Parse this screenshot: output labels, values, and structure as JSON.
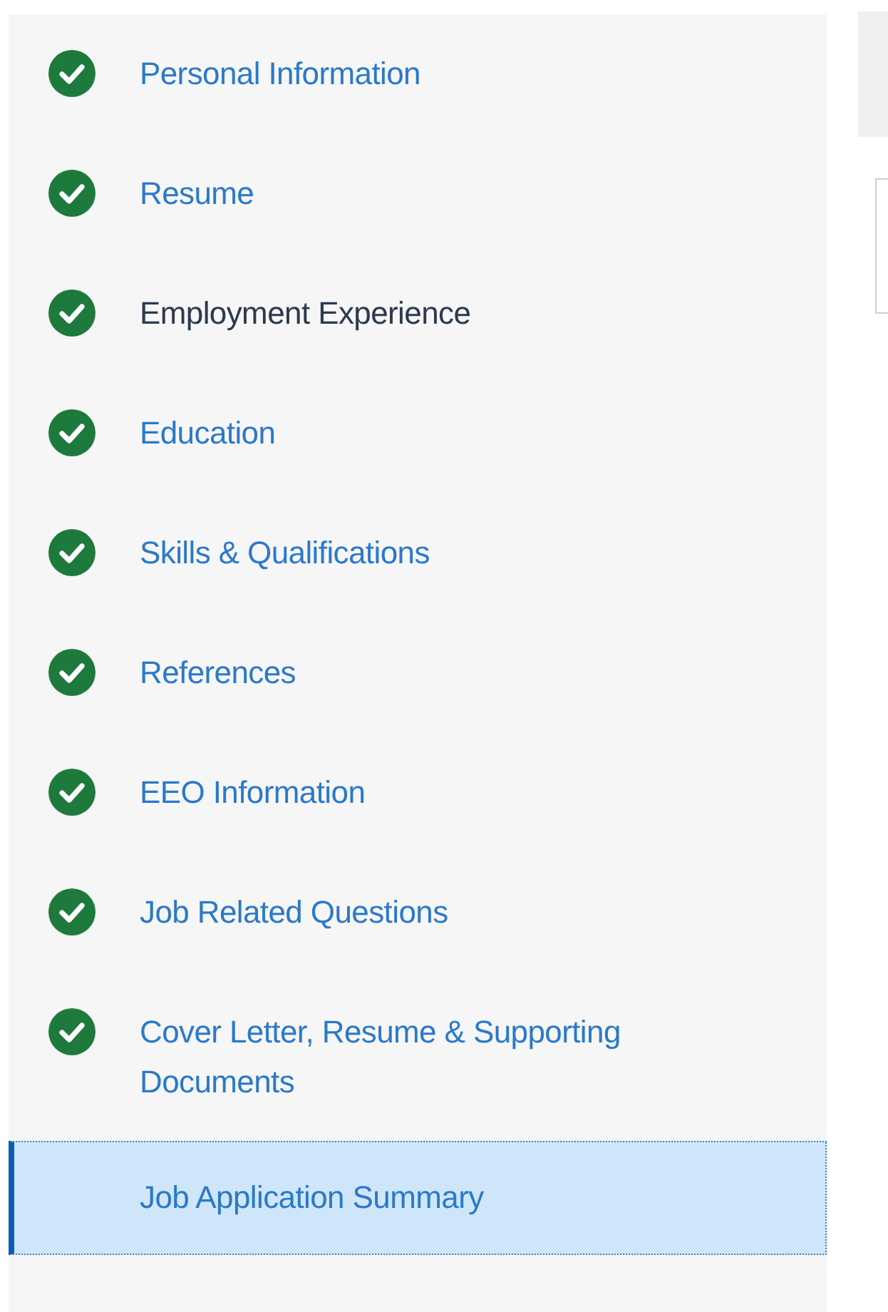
{
  "steps": [
    {
      "label": "Personal Information",
      "completed": true,
      "selected": false,
      "hovered": false
    },
    {
      "label": "Resume",
      "completed": true,
      "selected": false,
      "hovered": false
    },
    {
      "label": "Employment Experience",
      "completed": true,
      "selected": false,
      "hovered": true
    },
    {
      "label": "Education",
      "completed": true,
      "selected": false,
      "hovered": false
    },
    {
      "label": "Skills & Qualifications",
      "completed": true,
      "selected": false,
      "hovered": false
    },
    {
      "label": "References",
      "completed": true,
      "selected": false,
      "hovered": false
    },
    {
      "label": "EEO Information",
      "completed": true,
      "selected": false,
      "hovered": false
    },
    {
      "label": "Job Related Questions",
      "completed": true,
      "selected": false,
      "hovered": false
    },
    {
      "label": "Cover Letter, Resume & Supporting Documents",
      "completed": true,
      "selected": false,
      "hovered": false
    },
    {
      "label": "Job Application Summary",
      "completed": false,
      "selected": true,
      "hovered": false
    }
  ]
}
